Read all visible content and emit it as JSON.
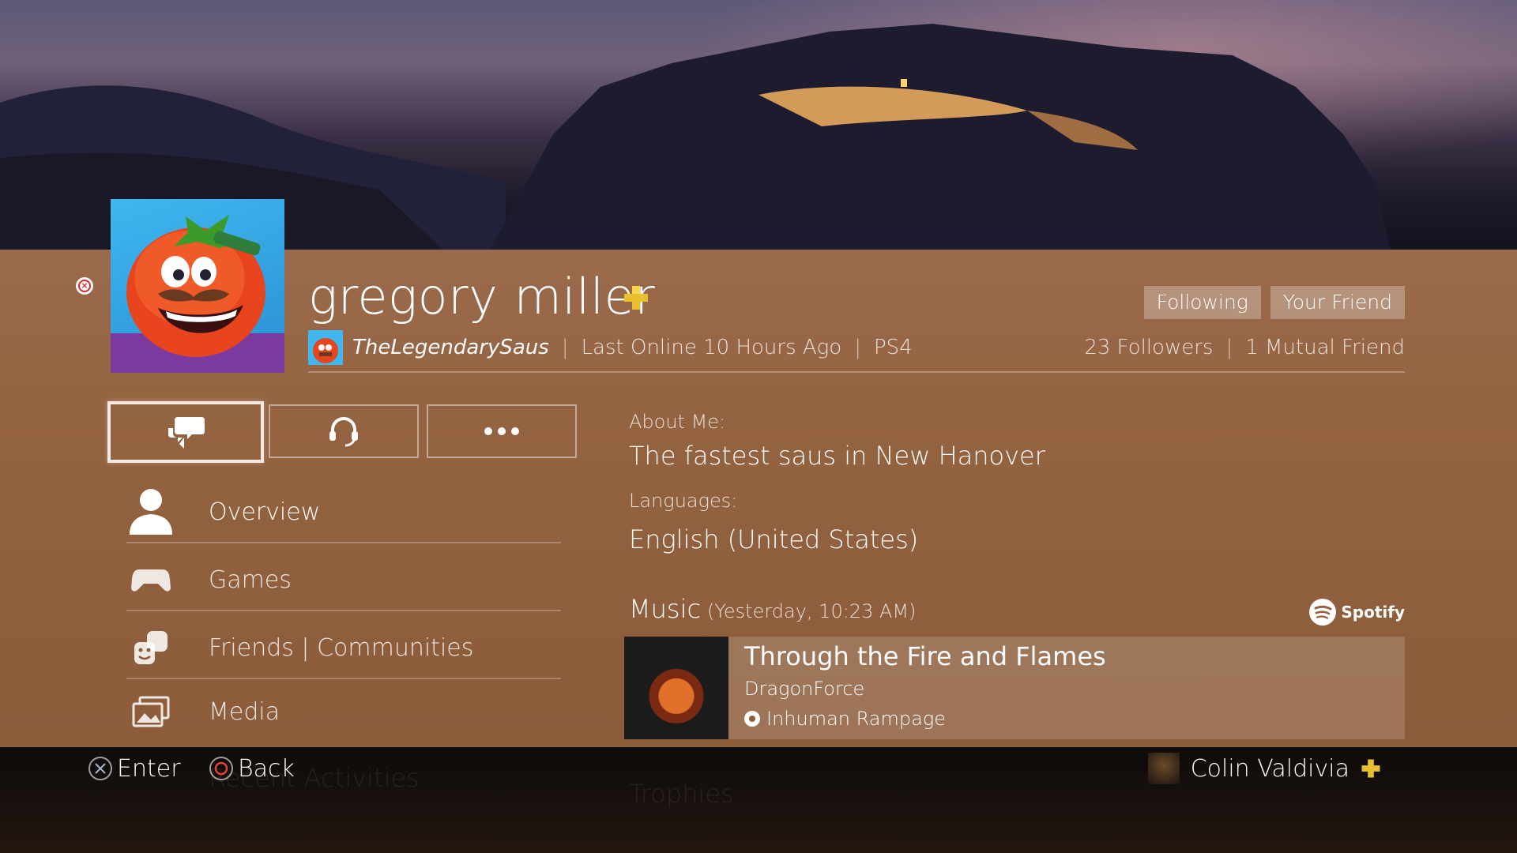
{
  "profile": {
    "name": "gregory miller",
    "online_id": "TheLegendarySaus",
    "last_online": "Last Online 10 Hours Ago",
    "platform": "PS4",
    "tags": [
      "Following",
      "Your Friend"
    ],
    "followers": "23 Followers",
    "mutual": "1 Mutual Friend"
  },
  "actions": [
    {
      "icon": "message-icon"
    },
    {
      "icon": "headset-icon"
    },
    {
      "icon": "more-options-icon"
    }
  ],
  "menu": [
    {
      "label": "Overview",
      "icon": "person-icon",
      "active": true
    },
    {
      "label": "Games",
      "icon": "controller-icon"
    },
    {
      "label": "Friends | Communities",
      "icon": "friends-icon"
    },
    {
      "label": "Media",
      "icon": "media-icon"
    }
  ],
  "about": {
    "label": "About Me:",
    "text": "The fastest saus in New Hanover",
    "languages_label": "Languages:",
    "languages": "English (United States)"
  },
  "music": {
    "heading": "Music",
    "timestamp": "(Yesterday, 10:23 AM)",
    "service": "Spotify",
    "track": "Through the Fire and Flames",
    "artist": "DragonForce",
    "album": "Inhuman Rampage"
  },
  "ghost": {
    "menu_item": "Recent Activities",
    "section": "Trophies"
  },
  "footer": {
    "enter": "Enter",
    "back": "Back",
    "user": "Colin Valdivia"
  },
  "colors": {
    "panel": "#93623f",
    "plus_gold": "#e8c02e",
    "close_red": "#d42a2a"
  }
}
